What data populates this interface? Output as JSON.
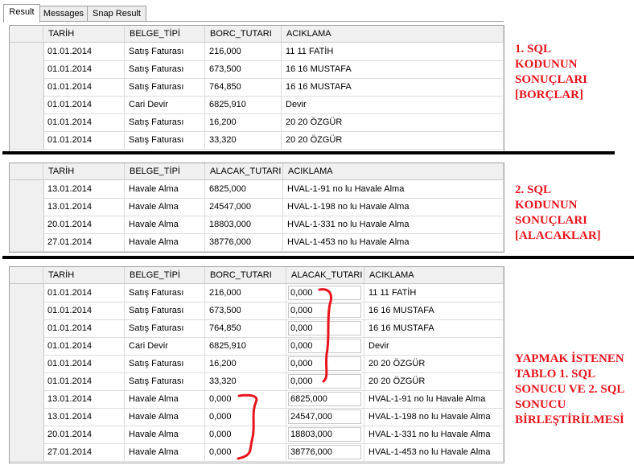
{
  "tabs": [
    "Result",
    "Messages",
    "Snap Result"
  ],
  "grid1": {
    "columns": [
      "TARİH",
      "BELGE_TİPİ",
      "BORC_TUTARI",
      "ACIKLAMA"
    ],
    "rows": [
      [
        "01.01.2014",
        "Satış Faturası",
        "216,000",
        "11 11 FATİH"
      ],
      [
        "01.01.2014",
        "Satış Faturası",
        "673,500",
        "16 16 MUSTAFA"
      ],
      [
        "01.01.2014",
        "Satış Faturası",
        "764,850",
        "16 16 MUSTAFA"
      ],
      [
        "01.01.2014",
        "Cari Devir",
        "6825,910",
        "Devir"
      ],
      [
        "01.01.2014",
        "Satış Faturası",
        "16,200",
        "20 20 ÖZGÜR"
      ],
      [
        "01.01.2014",
        "Satış Faturası",
        "33,320",
        "20 20 ÖZGÜR"
      ]
    ]
  },
  "grid2": {
    "columns": [
      "TARİH",
      "BELGE_TİPİ",
      "ALACAK_TUTARI",
      "ACIKLAMA"
    ],
    "rows": [
      [
        "13.01.2014",
        "Havale Alma",
        "6825,000",
        "HVAL-1-91 no lu Havale Alma"
      ],
      [
        "13.01.2014",
        "Havale Alma",
        "24547,000",
        "HVAL-1-198 no lu Havale Alma"
      ],
      [
        "20.01.2014",
        "Havale Alma",
        "18803,000",
        "HVAL-1-331 no lu Havale Alma"
      ],
      [
        "27.01.2014",
        "Havale Alma",
        "38776,000",
        "HVAL-1-453 no lu Havale Alma"
      ]
    ]
  },
  "grid3": {
    "columns": [
      "TARİH",
      "BELGE_TİPİ",
      "BORC_TUTARI",
      "ALACAK_TUTARI",
      "ACIKLAMA"
    ],
    "rows": [
      [
        "01.01.2014",
        "Satış Faturası",
        "216,000",
        "0,000",
        "11 11 FATİH"
      ],
      [
        "01.01.2014",
        "Satış Faturası",
        "673,500",
        "0,000",
        "16 16 MUSTAFA"
      ],
      [
        "01.01.2014",
        "Satış Faturası",
        "764,850",
        "0,000",
        "16 16 MUSTAFA"
      ],
      [
        "01.01.2014",
        "Cari Devir",
        "6825,910",
        "0,000",
        "Devir"
      ],
      [
        "01.01.2014",
        "Satış Faturası",
        "16,200",
        "0,000",
        "20 20 ÖZGÜR"
      ],
      [
        "01.01.2014",
        "Satış Faturası",
        "33,320",
        "0,000",
        "20 20 ÖZGÜR"
      ],
      [
        "13.01.2014",
        "Havale Alma",
        "0,000",
        "6825,000",
        "HVAL-1-91 no lu Havale Alma"
      ],
      [
        "13.01.2014",
        "Havale Alma",
        "0,000",
        "24547,000",
        "HVAL-1-198 no lu Havale Alma"
      ],
      [
        "20.01.2014",
        "Havale Alma",
        "0,000",
        "18803,000",
        "HVAL-1-331 no lu Havale Alma"
      ],
      [
        "27.01.2014",
        "Havale Alma",
        "0,000",
        "38776,000",
        "HVAL-1-453 no lu Havale Alma"
      ]
    ]
  },
  "annotations": {
    "note1": [
      "1. SQL",
      "KODUNUN",
      "SONUÇLARI",
      "[BORÇLAR]"
    ],
    "note2": [
      "2. SQL",
      "KODUNUN",
      "SONUÇLARI",
      "[ALACAKLAR]"
    ],
    "note3": [
      "YAPMAK İSTENEN",
      "TABLO 1. SQL",
      "SONUCU VE 2. SQL",
      "SONUCU",
      "BİRLEŞTİRİLMESİ"
    ],
    "color": "#e8141d"
  }
}
